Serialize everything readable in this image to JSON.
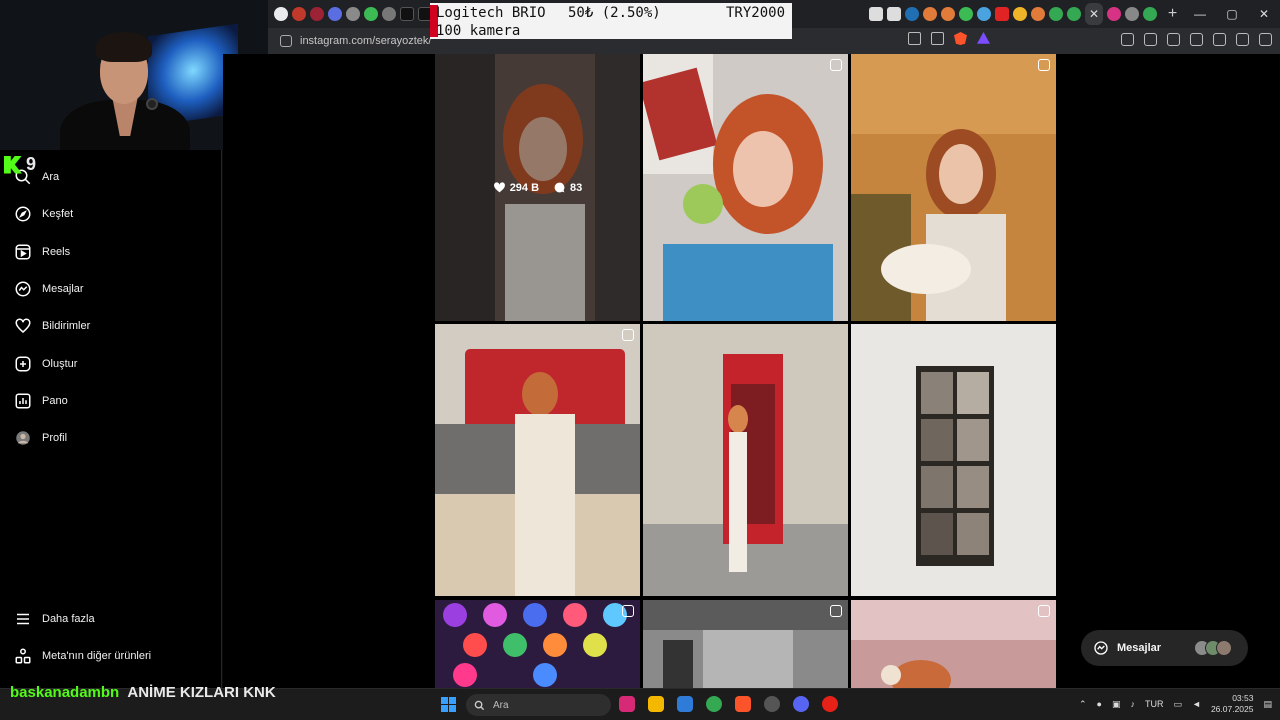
{
  "browser": {
    "url": "instagram.com/serayoztek/",
    "new_tab_label": "+",
    "window_controls": [
      "—",
      "▢",
      "✕"
    ]
  },
  "overlay": {
    "product": "Logitech BRIO",
    "price": "50₺ (2.50%)",
    "goal": "TRY2000",
    "note": "100 kamera"
  },
  "stream": {
    "viewer_count": "9",
    "chat_user": "baskanadambn",
    "chat_message": "ANİME KIZLARI KNK"
  },
  "sidebar": {
    "items": [
      {
        "label": "Ara",
        "icon": "search-icon"
      },
      {
        "label": "Keşfet",
        "icon": "compass-icon"
      },
      {
        "label": "Reels",
        "icon": "reels-icon"
      },
      {
        "label": "Mesajlar",
        "icon": "messenger-icon"
      },
      {
        "label": "Bildirimler",
        "icon": "heart-icon"
      },
      {
        "label": "Oluştur",
        "icon": "plus-square-icon"
      },
      {
        "label": "Pano",
        "icon": "chart-icon"
      },
      {
        "label": "Profil",
        "icon": "avatar-icon"
      }
    ],
    "more": "Daha fazla",
    "meta": "Meta'nın diğer ürünleri"
  },
  "feed": {
    "hovered_post": {
      "likes": "294 B",
      "comments": "83"
    }
  },
  "messages_button": {
    "label": "Mesajlar"
  },
  "taskbar": {
    "search_placeholder": "Ara",
    "language": "TUR",
    "time": "03:53",
    "date": "26.07.2025"
  }
}
